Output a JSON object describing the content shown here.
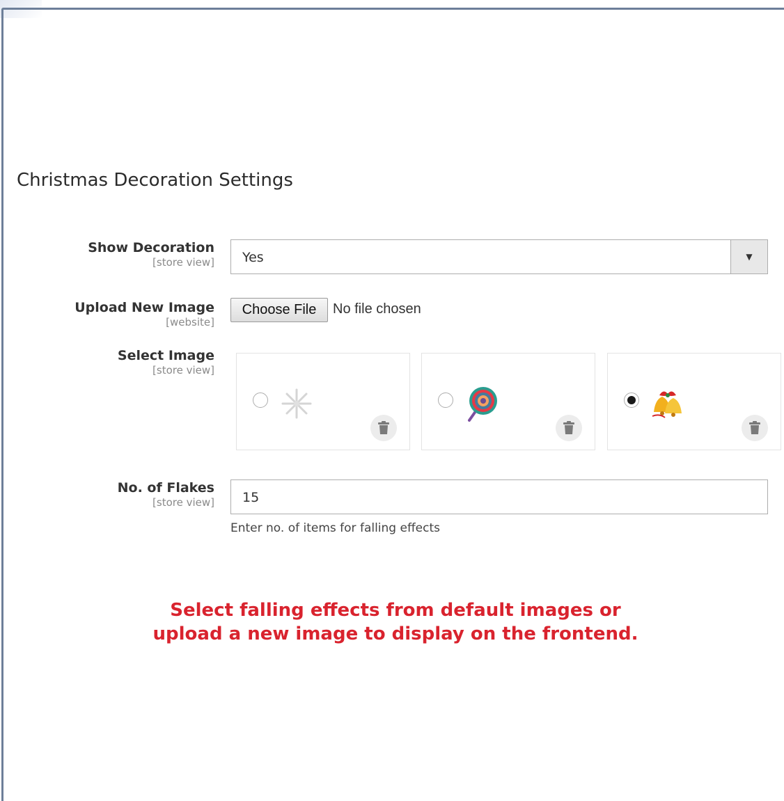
{
  "section": {
    "title": "Christmas Decoration Settings"
  },
  "show_decoration": {
    "label": "Show Decoration",
    "scope": "[store view]",
    "value": "Yes"
  },
  "upload_image": {
    "label": "Upload New Image",
    "scope": "[website]",
    "button": "Choose File",
    "status": "No file chosen"
  },
  "select_image": {
    "label": "Select Image",
    "scope": "[store view]",
    "options": [
      {
        "icon": "snowflake-icon",
        "selected": false
      },
      {
        "icon": "lollipop-icon",
        "selected": false
      },
      {
        "icon": "bells-icon",
        "selected": true
      }
    ]
  },
  "flakes": {
    "label": "No. of Flakes",
    "scope": "[store view]",
    "value": "15",
    "note": "Enter no. of items for falling effects"
  },
  "callout": {
    "line1": "Select falling effects from default images or",
    "line2": "upload a new image to display on the frontend."
  },
  "colors": {
    "frame": "#6d7f99",
    "callout": "#d9232e"
  }
}
